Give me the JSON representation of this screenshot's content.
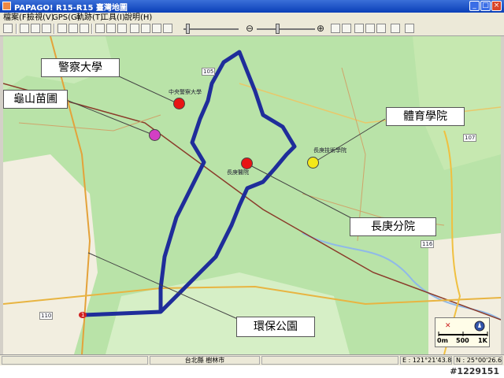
{
  "window": {
    "title": "PAPAGO! R15-R15 臺灣地圖",
    "minimize": "_",
    "maximize": "□",
    "close": "×"
  },
  "menu": [
    "檔案(F)",
    "檢視(V)",
    "GPS(G)",
    "軌跡(T)",
    "工具(I)",
    "說明(H)"
  ],
  "toolbar": {
    "zoom_out": "⊖",
    "zoom_in": "⊕"
  },
  "callouts": {
    "police_university": "警察大學",
    "guishan_nursery": "龜山苗圃",
    "sports_college": "體育學院",
    "changgung_branch": "長庚分院",
    "eco_park": "環保公園"
  },
  "map_labels": {
    "police_map": "中央警察大學",
    "sports_map": "長庚技術學院",
    "changgung_map": "長庚醫院",
    "road_105": "105",
    "road_110": "110",
    "road_116": "116",
    "road_107": "107",
    "road_1": "1"
  },
  "colors": {
    "route": "#1f2d9a",
    "police_marker": "#e81515",
    "nursery_marker": "#d23fc4",
    "sports_marker": "#f3e81a",
    "changgung_marker": "#e81515",
    "map_bg": "#b9e3a8"
  },
  "scale": {
    "t0": "0m",
    "t1": "500",
    "t2": "1K"
  },
  "status": {
    "region": "台北縣 樹林市",
    "longitude": "E : 121°21'43.8\"",
    "latitude": "N : 25°00'26.6\""
  },
  "watermark": "#1229151"
}
